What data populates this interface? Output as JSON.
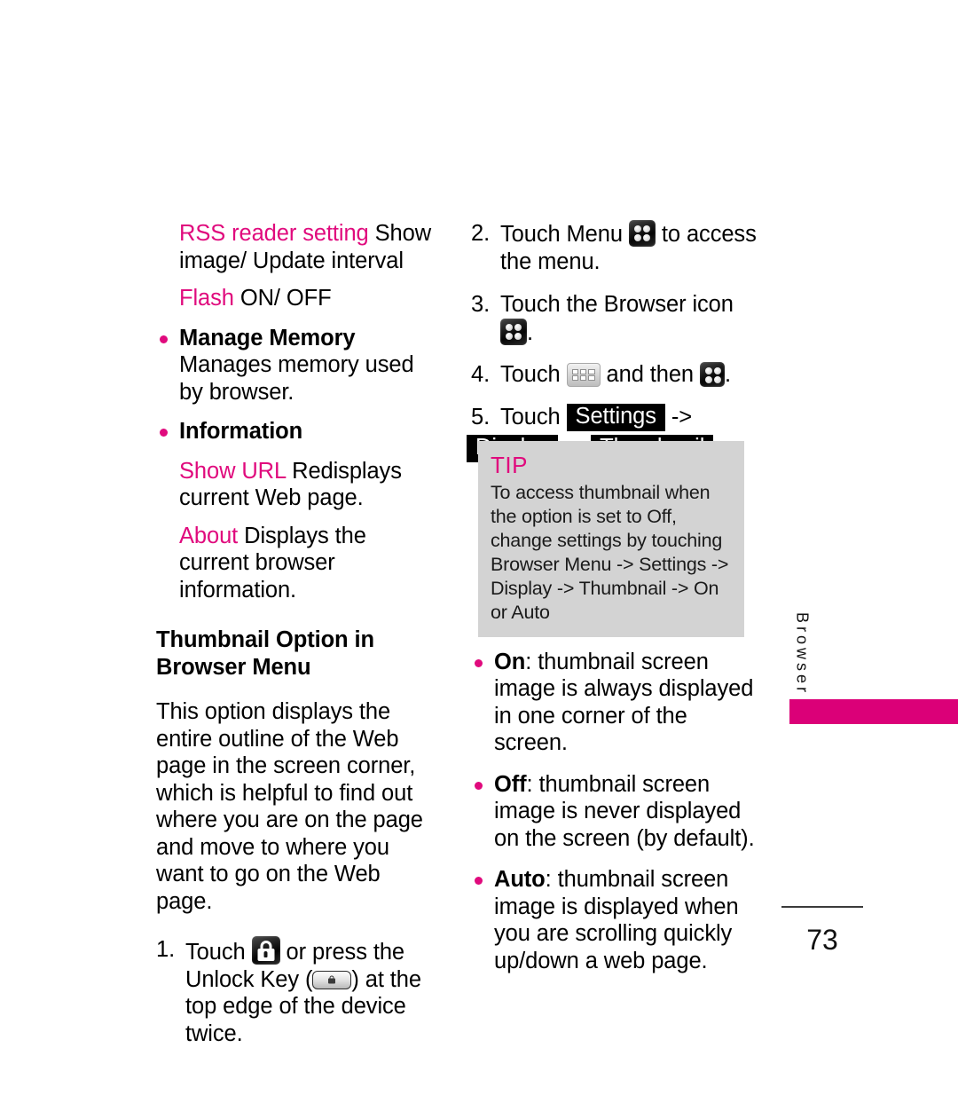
{
  "colors": {
    "accent_magenta": "#E00A7D",
    "tab_bar_magenta": "#DB0078",
    "tip_background": "#d3d3d3",
    "chip_background": "#000000",
    "text": "#000000"
  },
  "left_column": {
    "rss": {
      "term": "RSS reader setting",
      "description": " Show image/ Update interval"
    },
    "flash": {
      "term": "Flash",
      "description": " ON/ OFF"
    },
    "manage_memory": {
      "term": "Manage Memory",
      "description": " Manages memory used by browser."
    },
    "information": {
      "term": "Information"
    },
    "show_url": {
      "term": "Show URL",
      "description": " Redisplays current Web page."
    },
    "about": {
      "term": "About",
      "description": " Displays the current browser information."
    },
    "section_heading": "Thumbnail Option in Browser Menu",
    "intro_paragraph": "This option displays the entire outline of the Web page in the screen corner, which is helpful to find out where you are on the page and move to where you want to go on the Web page.",
    "step1": {
      "number": "1.",
      "text_before_icon": "Touch",
      "icon": "lock-icon",
      "text_middle": "or press the Unlock Key (",
      "key_icon": "unlock-key-icon",
      "text_after": ") at the top edge of the device twice."
    }
  },
  "right_column": {
    "step2": {
      "number": "2.",
      "text_before_icon": "Touch Menu",
      "icon": "menu-dots-icon",
      "text_after": "to access the menu."
    },
    "step3": {
      "number": "3.",
      "text_before_icon": "Touch the Browser icon",
      "icon": "browser-dots-icon",
      "text_after": "."
    },
    "step4": {
      "number": "4.",
      "text_before_icon": "Touch",
      "icon_first": "keypad-icon",
      "text_middle": "and then",
      "icon_second": "menu-dots-icon",
      "text_after": "."
    },
    "step5": {
      "number": "5.",
      "text_before": "Touch",
      "chip1": "Settings",
      "arrow1": "->",
      "chip2": "Display",
      "arrow2": "->",
      "chip3": "Thumbnail",
      "text_after": "."
    },
    "tip": {
      "title": "TIP",
      "body": "To access thumbnail when the option is set to Off, change settings by touching Browser Menu -> Settings -> Display -> Thumbnail -> On or Auto"
    },
    "options": [
      {
        "term": "On",
        "description": ": thumbnail screen image is always displayed in one corner of the screen."
      },
      {
        "term": "Off",
        "description": ": thumbnail screen image is never displayed on the screen (by default)."
      },
      {
        "term": "Auto",
        "description": ": thumbnail screen image is displayed when you are scrolling quickly up/down a web page."
      }
    ]
  },
  "margin_tab": {
    "label": "Browser"
  },
  "footer": {
    "page_number": "73"
  }
}
